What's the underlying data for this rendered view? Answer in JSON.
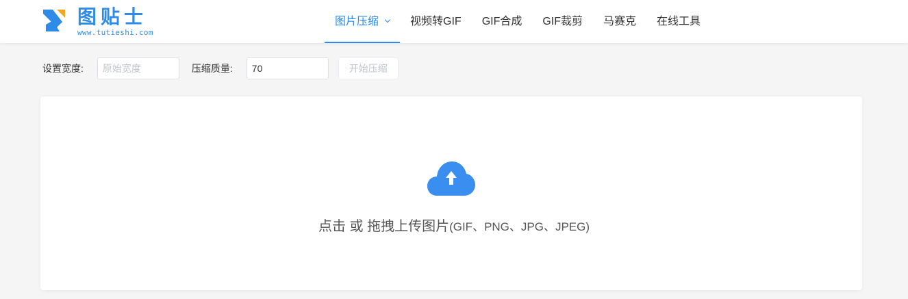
{
  "header": {
    "logo": {
      "title": "图贴士",
      "url": "www.tutieshi.com"
    },
    "nav": [
      {
        "label": "图片压缩",
        "active": true,
        "dropdown": true
      },
      {
        "label": "视频转GIF"
      },
      {
        "label": "GIF合成"
      },
      {
        "label": "GIF裁剪"
      },
      {
        "label": "马赛克"
      },
      {
        "label": "在线工具"
      }
    ]
  },
  "toolbar": {
    "width_label": "设置宽度:",
    "width_placeholder": "原始宽度",
    "width_value": "",
    "quality_label": "压缩质量:",
    "quality_value": "70",
    "start_button": "开始压缩"
  },
  "upload": {
    "icon": "cloud-upload-icon",
    "main_text": "点击 或 拖拽上传图片",
    "formats": "(GIF、PNG、JPG、JPEG)"
  },
  "colors": {
    "accent": "#2f8be8",
    "cloud": "#3a8ef0"
  }
}
